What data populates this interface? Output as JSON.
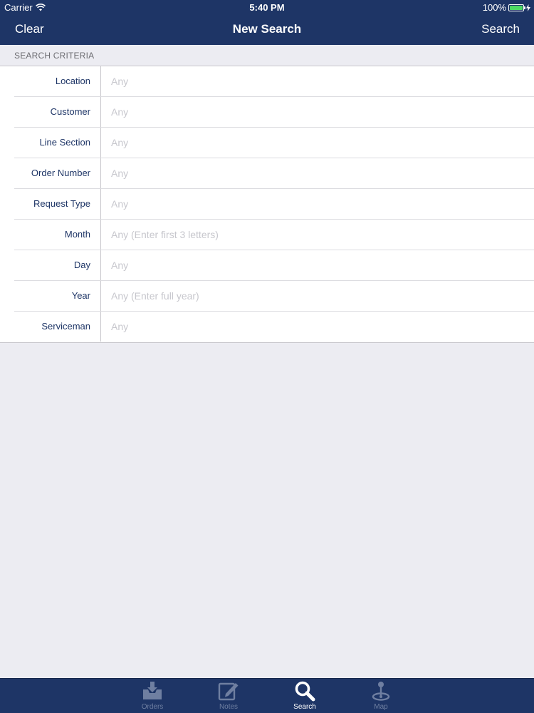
{
  "status_bar": {
    "carrier": "Carrier",
    "time": "5:40 PM",
    "battery": "100%",
    "battery_level": 1.0
  },
  "nav": {
    "left_button": "Clear",
    "title": "New Search",
    "right_button": "Search"
  },
  "section": {
    "header": "SEARCH CRITERIA"
  },
  "fields": [
    {
      "label": "Location",
      "placeholder": "Any",
      "value": ""
    },
    {
      "label": "Customer",
      "placeholder": "Any",
      "value": ""
    },
    {
      "label": "Line Section",
      "placeholder": "Any",
      "value": ""
    },
    {
      "label": "Order Number",
      "placeholder": "Any",
      "value": ""
    },
    {
      "label": "Request Type",
      "placeholder": "Any",
      "value": ""
    },
    {
      "label": "Month",
      "placeholder": "Any (Enter first 3 letters)",
      "value": ""
    },
    {
      "label": "Day",
      "placeholder": "Any",
      "value": ""
    },
    {
      "label": "Year",
      "placeholder": "Any (Enter full year)",
      "value": ""
    },
    {
      "label": "Serviceman",
      "placeholder": "Any",
      "value": ""
    }
  ],
  "tabs": [
    {
      "label": "Orders",
      "icon": "inbox-download-icon",
      "active": false
    },
    {
      "label": "Notes",
      "icon": "compose-icon",
      "active": false
    },
    {
      "label": "Search",
      "icon": "magnifier-icon",
      "active": true
    },
    {
      "label": "Map",
      "icon": "map-pin-icon",
      "active": false
    }
  ],
  "colors": {
    "nav_background": "#1e3566",
    "page_background": "#ececf2",
    "label_text": "#1e3566",
    "placeholder_text": "#c7c7cd",
    "battery_fill": "#4cd964",
    "tab_inactive": "#6f7fa1",
    "tab_active": "#ffffff"
  }
}
